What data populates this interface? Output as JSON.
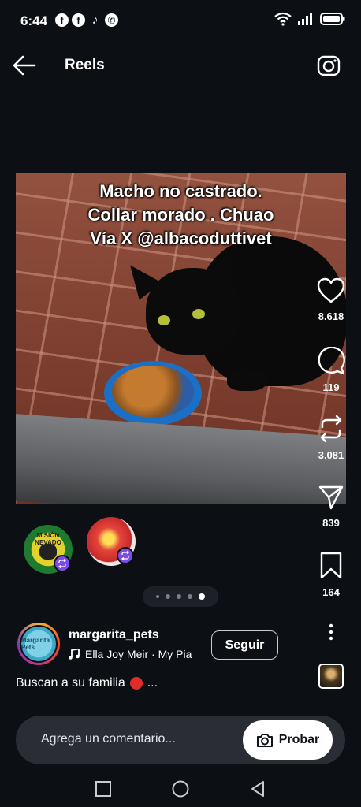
{
  "status_bar": {
    "time": "6:44",
    "notifications": [
      "facebook-icon",
      "facebook-icon",
      "tiktok-icon",
      "whatsapp-icon"
    ],
    "icons": [
      "wifi-icon",
      "signal-icon",
      "battery-icon"
    ]
  },
  "header": {
    "title": "Reels",
    "back_icon": "arrow-left-icon",
    "camera_icon": "camera-icon"
  },
  "reel": {
    "caption_lines": [
      "Macho no castrado.",
      "Collar morado . Chuao",
      "Vía X  @albacoduttivet"
    ]
  },
  "actions": {
    "likes": "8.618",
    "comments": "119",
    "reposts": "3.081",
    "shares": "839",
    "saves": "164"
  },
  "pagination": {
    "total": 5,
    "active": 4
  },
  "author": {
    "username": "margarita_pets",
    "music": "Ella Joy Meir · My Pia",
    "follow_label": "Seguir",
    "description": "Buscan a su familia",
    "description_suffix": "...",
    "avatar_text": "Margarita Pets",
    "collab_text": "MISIÓN NEVADO"
  },
  "comment_bar": {
    "placeholder": "Agrega un comentario...",
    "try_label": "Probar"
  },
  "colors": {
    "background": "#0c0f14",
    "accent_badge": "#7b4de8",
    "status_red": "#e32b2b"
  }
}
